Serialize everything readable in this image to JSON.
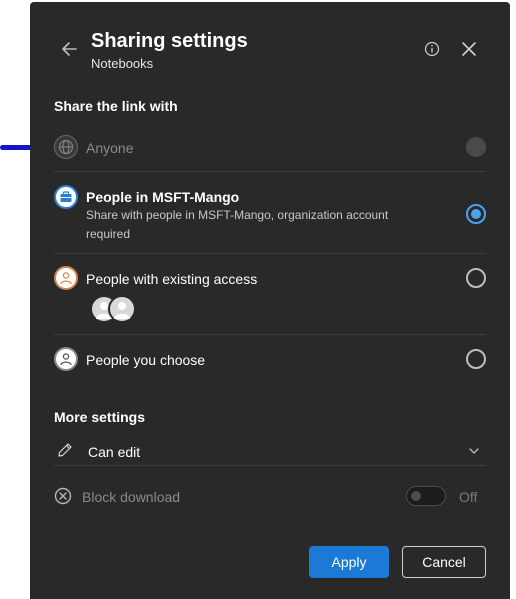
{
  "header": {
    "title": "Sharing settings",
    "subtitle": "Notebooks",
    "icons": {
      "back": "arrow-left-icon",
      "info": "info-icon",
      "close": "close-icon"
    }
  },
  "share_section": {
    "label": "Share the link with",
    "options": [
      {
        "label": "Anyone",
        "description": "",
        "icon": "globe-icon",
        "selected": false,
        "disabled": true
      },
      {
        "label": "People in MSFT-Mango",
        "description": "Share with people in MSFT-Mango, organization account required",
        "icon": "briefcase-icon",
        "selected": true,
        "disabled": false
      },
      {
        "label": "People with existing access",
        "description": "",
        "icon": "person-icon",
        "selected": false,
        "disabled": false
      },
      {
        "label": "People you choose",
        "description": "",
        "icon": "person-icon",
        "selected": false,
        "disabled": false
      }
    ]
  },
  "more_settings": {
    "label": "More settings",
    "permission": {
      "label": "Can edit",
      "icon": "pencil-icon"
    },
    "block_download": {
      "label": "Block download",
      "toggle_state": "Off",
      "enabled": false
    }
  },
  "footer": {
    "apply_label": "Apply",
    "cancel_label": "Cancel"
  },
  "colors": {
    "panel_bg": "#292929",
    "accent": "#1a7ad6",
    "selected_radio": "#4aa3f0",
    "marker": "#1414c8"
  }
}
